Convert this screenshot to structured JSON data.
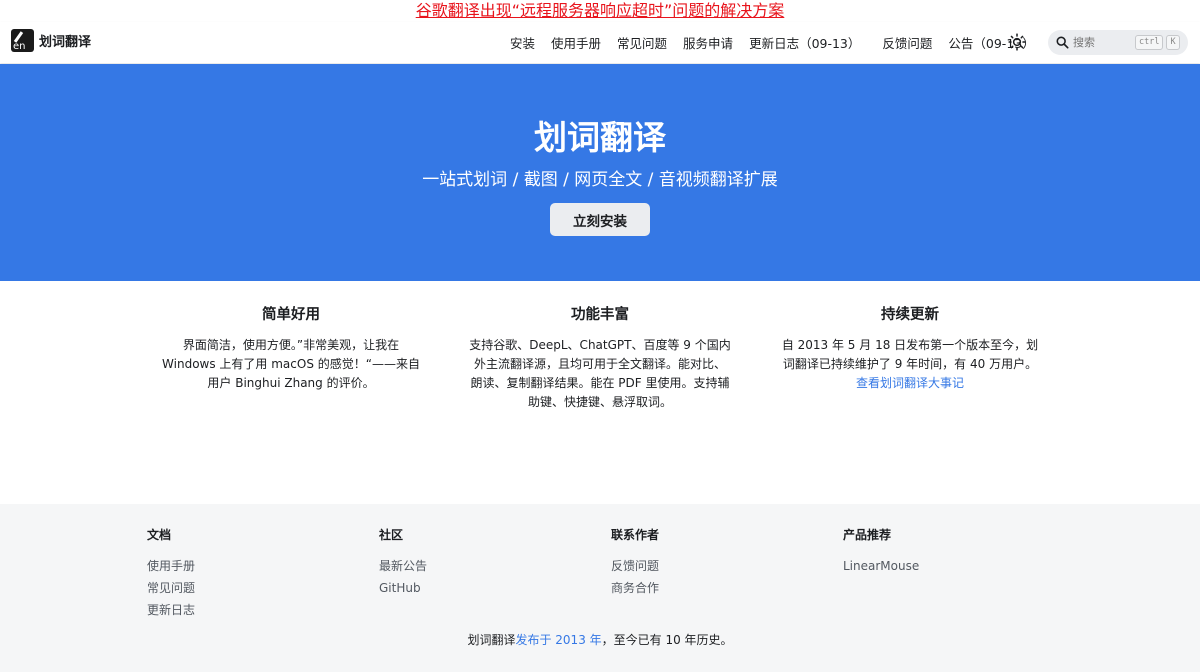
{
  "banner": {
    "text": "谷歌翻译出现“远程服务器响应超时”问题的解决方案",
    "color": "#e8141c"
  },
  "navbar": {
    "brand_logo_text": "en",
    "brand_title": "划词翻译",
    "items": [
      {
        "label": "安装"
      },
      {
        "label": "使用手册"
      },
      {
        "label": "常见问题"
      },
      {
        "label": "服务申请"
      },
      {
        "label": "更新日志（09-13）"
      },
      {
        "label": "反馈问题"
      },
      {
        "label": "公告（09-13）"
      }
    ],
    "theme_icon": "sun-icon",
    "search": {
      "placeholder": "搜索",
      "shortcut_keys": [
        "ctrl",
        "K"
      ]
    }
  },
  "hero": {
    "title": "划词翻译",
    "subtitle": "一站式划词 / 截图 / 网页全文 / 音视频翻译扩展",
    "button_label": "立刻安装",
    "background": "#3578e5"
  },
  "features": [
    {
      "title": "简单好用",
      "desc": "界面简洁，使用方便。”非常美观，让我在 Windows 上有了用 macOS 的感觉！“——来自用户 Binghui Zhang 的评价。"
    },
    {
      "title": "功能丰富",
      "desc": "支持谷歌、DeepL、ChatGPT、百度等 9 个国内外主流翻译源，且均可用于全文翻译。能对比、朗读、复制翻译结果。能在 PDF 里使用。支持辅助键、快捷键、悬浮取词。"
    },
    {
      "title": "持续更新",
      "desc": "自 2013 年 5 月 18 日发布第一个版本至今，划词翻译已持续维护了 9 年时间，有 40 万用户。",
      "link_text": "查看划词翻译大事记"
    }
  ],
  "footer": {
    "columns": [
      {
        "title": "文档",
        "links": [
          "使用手册",
          "常见问题",
          "更新日志"
        ]
      },
      {
        "title": "社区",
        "links": [
          "最新公告",
          "GitHub"
        ]
      },
      {
        "title": "联系作者",
        "links": [
          "反馈问题",
          "商务合作"
        ]
      },
      {
        "title": "产品推荐",
        "links": [
          "LinearMouse"
        ]
      }
    ],
    "copyright": {
      "prefix": "划词翻译",
      "link_text": "发布于 2013 年",
      "suffix": "，至今已有 10 年历史。"
    }
  }
}
